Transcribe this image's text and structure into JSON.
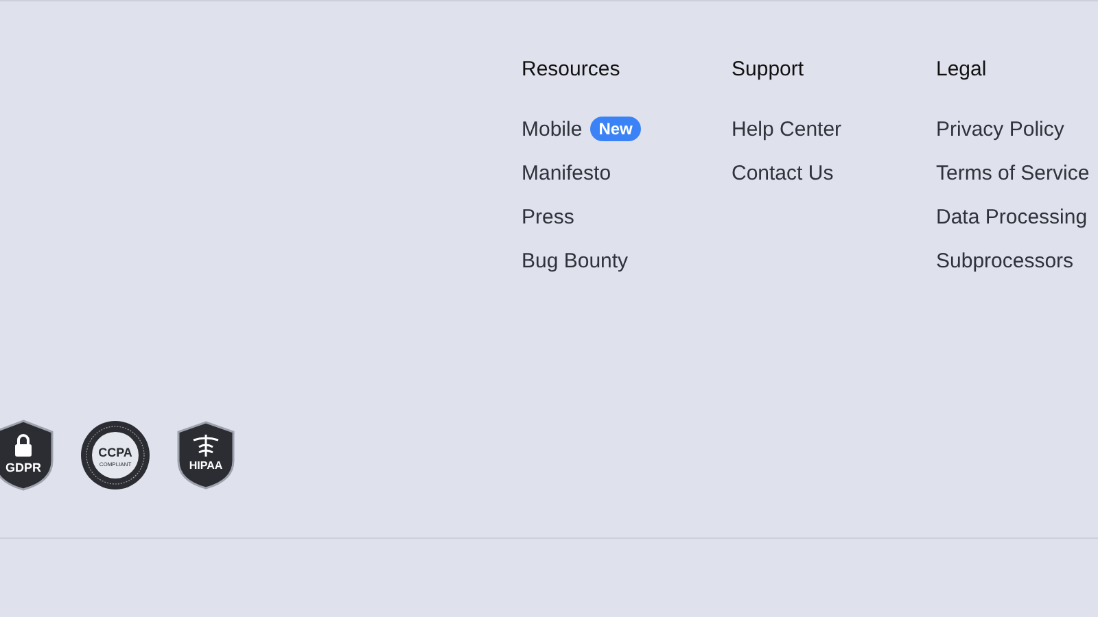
{
  "columns": [
    {
      "heading": "Resources",
      "links": [
        {
          "label": "Mobile",
          "badge": "New"
        },
        {
          "label": "Manifesto"
        },
        {
          "label": "Press"
        },
        {
          "label": "Bug Bounty"
        }
      ]
    },
    {
      "heading": "Support",
      "links": [
        {
          "label": "Help Center"
        },
        {
          "label": "Contact Us"
        }
      ]
    },
    {
      "heading": "Legal",
      "links": [
        {
          "label": "Privacy Policy"
        },
        {
          "label": "Terms of Service"
        },
        {
          "label": "Data Processing"
        },
        {
          "label": "Subprocessors"
        }
      ]
    }
  ],
  "badges": [
    {
      "kind": "gdpr",
      "label": "GDPR"
    },
    {
      "kind": "ccpa",
      "label": "CCPA",
      "sublabel": "COMPLIANT"
    },
    {
      "kind": "hipaa",
      "label": "HIPAA"
    }
  ]
}
